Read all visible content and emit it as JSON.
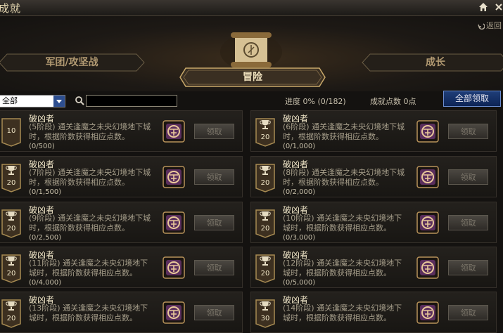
{
  "window": {
    "title": "成就"
  },
  "back_label": "返回",
  "tabs": {
    "legion": "军团/攻坚战",
    "adventure": "冒险",
    "growth": "成长"
  },
  "filter": {
    "category": "全部",
    "search_value": ""
  },
  "stats": {
    "progress": "进度  0%  (0/182)",
    "points": "成就点数 0点"
  },
  "claim_all_label": "全部领取",
  "claim_label": "领取",
  "achievements": [
    {
      "title": "破凶者",
      "desc": "(5阶段) 通关逢魔之未央幻境地下城时，根据阶数获得相应点数。",
      "progress": "(0/500)",
      "points": "10",
      "icon": "trophy-icon",
      "reward_icon": "reward-emblem-icon"
    },
    {
      "title": "破凶者",
      "desc": "(6阶段) 通关逢魔之未央幻境地下城时，根据阶数获得相应点数。",
      "progress": "(0/1,000)",
      "points": "20",
      "icon": "trophy-icon",
      "reward_icon": "reward-emblem-icon"
    },
    {
      "title": "破凶者",
      "desc": "(7阶段) 通关逢魔之未央幻境地下城时，根据阶数获得相应点数。",
      "progress": "(0/1,500)",
      "points": "20",
      "icon": "trophy-icon",
      "reward_icon": "reward-emblem-icon"
    },
    {
      "title": "破凶者",
      "desc": "(8阶段) 通关逢魔之未央幻境地下城时，根据阶数获得相应点数。",
      "progress": "(0/2,000)",
      "points": "20",
      "icon": "trophy-icon",
      "reward_icon": "reward-emblem-icon"
    },
    {
      "title": "破凶者",
      "desc": "(9阶段) 通关逢魔之未央幻境地下城时，根据阶数获得相应点数。",
      "progress": "(0/2,500)",
      "points": "20",
      "icon": "trophy-icon",
      "reward_icon": "reward-emblem-icon"
    },
    {
      "title": "破凶者",
      "desc": "(10阶段) 通关逢魔之未央幻境地下城时，根据阶数获得相应点数。",
      "progress": "(0/3,000)",
      "points": "20",
      "icon": "trophy-icon",
      "reward_icon": "reward-emblem-icon"
    },
    {
      "title": "破凶者",
      "desc": "(11阶段) 通关逢魔之未央幻境地下城时，根据阶数获得相应点数。",
      "progress": "(0/4,000)",
      "points": "20",
      "icon": "trophy-icon",
      "reward_icon": "reward-emblem-icon"
    },
    {
      "title": "破凶者",
      "desc": "(12阶段) 通关逢魔之未央幻境地下城时，根据阶数获得相应点数。",
      "progress": "(0/5,000)",
      "points": "20",
      "icon": "trophy-icon",
      "reward_icon": "reward-emblem-icon"
    },
    {
      "title": "破凶者",
      "desc": "(13阶段) 通关逢魔之未央幻境地下城时，根据阶数获得相应点数。",
      "progress": "",
      "points": "20",
      "icon": "trophy-icon",
      "reward_icon": "reward-emblem-icon"
    },
    {
      "title": "破凶者",
      "desc": "(14阶段) 通关逢魔之未央幻境地下城时，根据阶数获得相应点数。",
      "progress": "",
      "points": "30",
      "icon": "trophy-icon",
      "reward_icon": "reward-emblem-icon"
    }
  ],
  "colors": {
    "accent_gold": "#c9a96a",
    "claim_all_blue": "#1f3e78",
    "card_bg": "#1f1c18"
  }
}
